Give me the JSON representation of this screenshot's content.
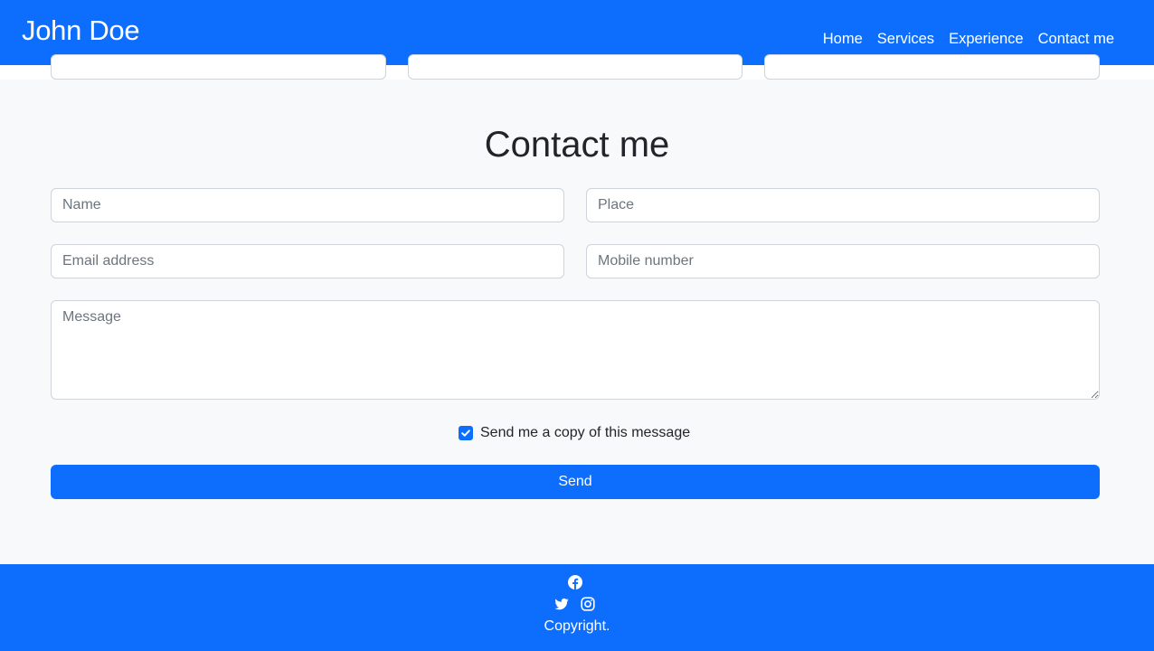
{
  "brand": "John Doe",
  "nav": {
    "items": [
      {
        "label": "Home"
      },
      {
        "label": "Services"
      },
      {
        "label": "Experience"
      },
      {
        "label": "Contact me"
      }
    ]
  },
  "contact": {
    "title": "Contact me",
    "fields": {
      "name": {
        "placeholder": "Name",
        "value": ""
      },
      "place": {
        "placeholder": "Place",
        "value": ""
      },
      "email": {
        "placeholder": "Email address",
        "value": ""
      },
      "mobile": {
        "placeholder": "Mobile number",
        "value": ""
      },
      "message": {
        "placeholder": "Message",
        "value": ""
      }
    },
    "copy_checkbox": {
      "label": "Send me a copy of this message",
      "checked": true
    },
    "send_label": "Send"
  },
  "footer": {
    "icons": [
      "facebook-icon",
      "twitter-icon",
      "instagram-icon"
    ],
    "copyright": "Copyright."
  },
  "colors": {
    "primary": "#0d6efd",
    "section_bg": "#f8f9fa",
    "text": "#212529",
    "placeholder": "#6c757d",
    "border": "#ced4da"
  }
}
